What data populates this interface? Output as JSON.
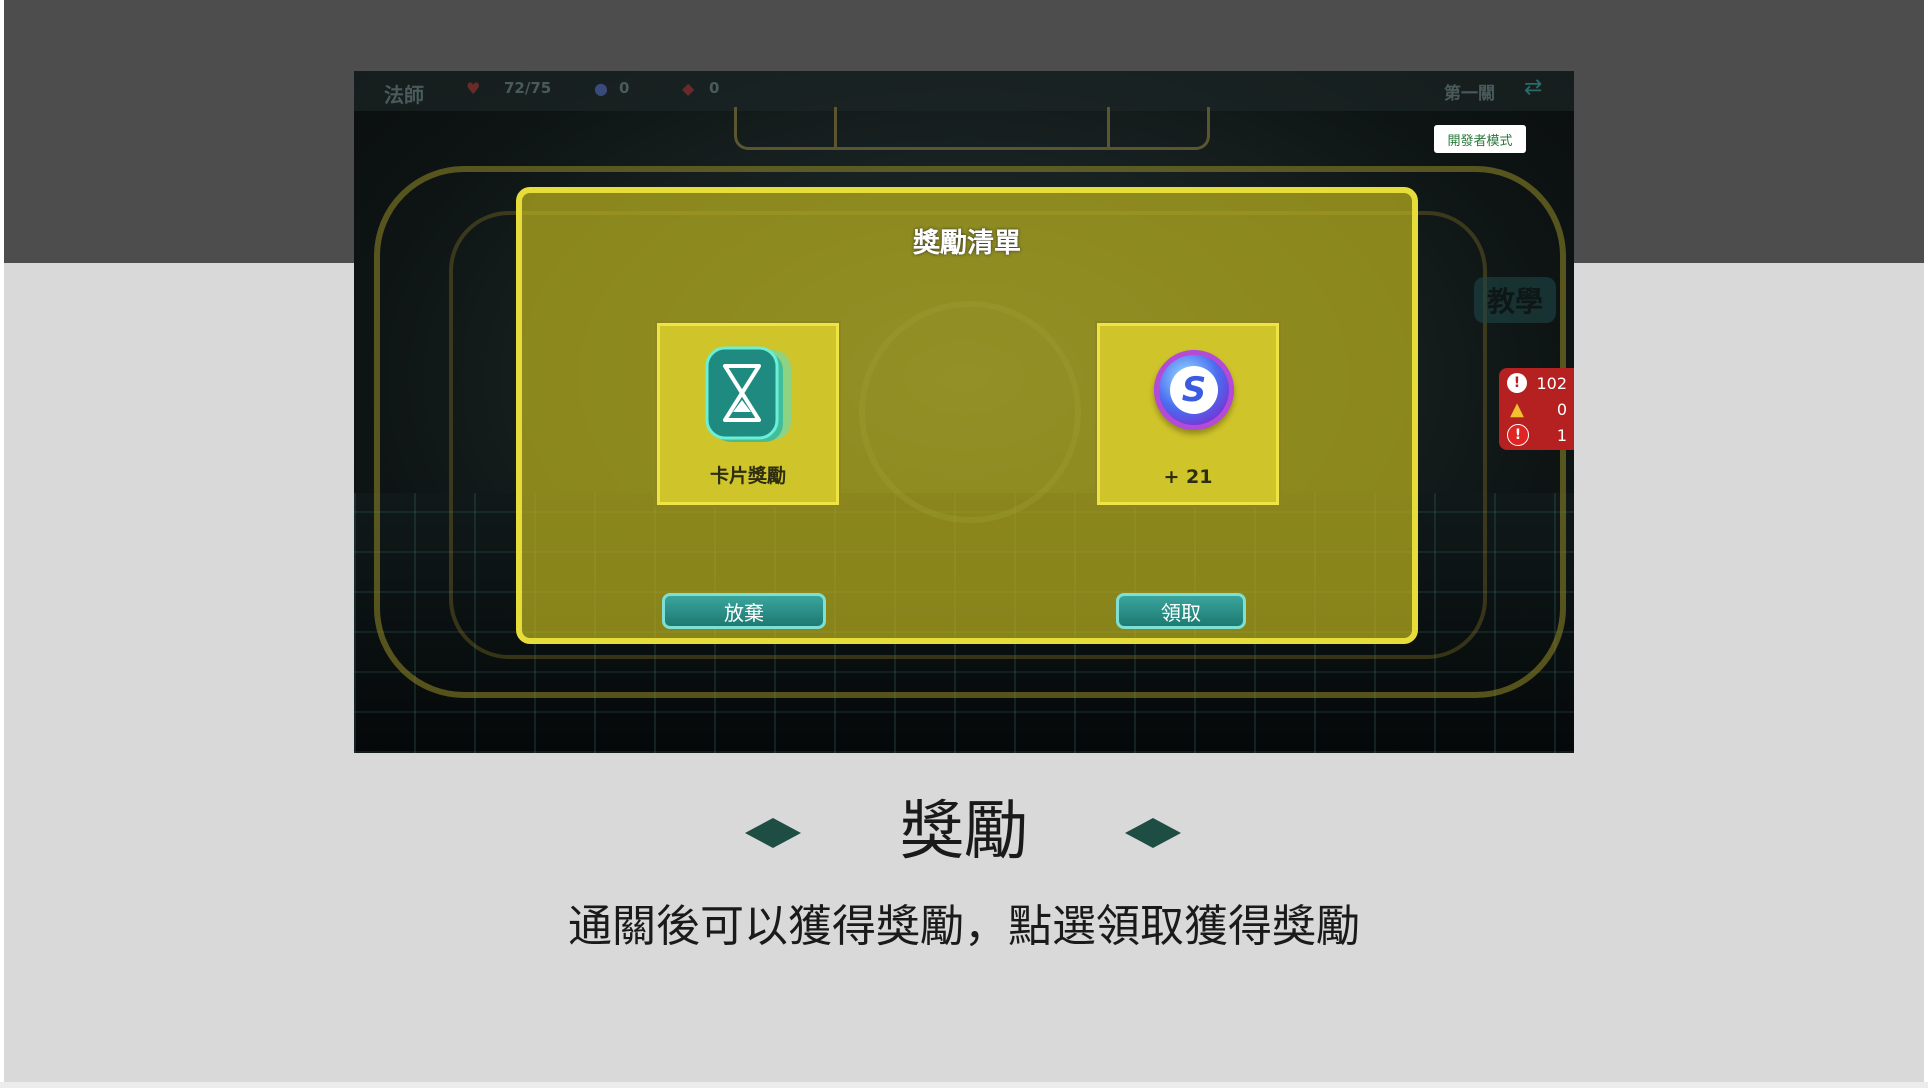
{
  "game": {
    "hud": {
      "character": "法師",
      "hp": "72/75",
      "mana": "0",
      "gems": "0",
      "stage": "第一關"
    },
    "dev_mode_label": "開發者模式",
    "tutorial_label": "教學",
    "debug_counts": {
      "info": "102",
      "warnings": "0",
      "errors": "1"
    },
    "reward_dialog": {
      "title": "獎勵清單",
      "card_reward_label": "卡片獎勵",
      "coin_reward_label": "+ 21",
      "abandon_button": "放棄",
      "claim_button": "領取"
    }
  },
  "caption": {
    "title": "獎勵",
    "subtitle": "通關後可以獲得獎勵，點選領取獲得獎勵"
  },
  "colors": {
    "slide_top": "#4d4d4d",
    "slide_bg": "#d9d9d9",
    "dialog_yellow": "#e6dc3a",
    "button_teal": "#1d7a72",
    "diamond": "#1e4d44",
    "debug_red": "#b52020"
  },
  "icons": {
    "hourglass_card": "hourglass-card-icon",
    "coin": "s-coin-icon",
    "diamond_left": "diamond-left-icon",
    "diamond_right": "diamond-right-icon"
  }
}
